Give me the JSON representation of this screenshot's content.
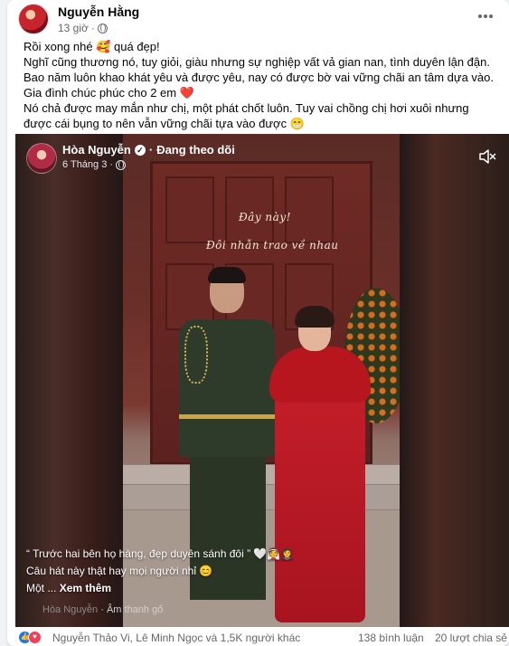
{
  "post": {
    "author": "Nguyễn Hằng",
    "time": "13 giờ",
    "visibility_icon": "globe-icon",
    "caption_lines": [
      "Rồi xong nhé 🥰 quá đẹp!",
      "Nghĩ cũng thương nó, tuy giỏi, giàu nhưng sự nghiệp vất vả gian nan, tình duyên lận đận. Bao năm luôn khao khát yêu và được yêu, nay có được bờ vai vững chãi an tâm dựa vào. Gia đình chúc phúc cho 2 em ❤️",
      "Nó chả được may mắn như chị, một phát chốt luôn. Tuy vai chồng chị hơi xuôi nhưng được cái bụng to nên vẫn vững chãi tựa vào được 😁"
    ]
  },
  "reel": {
    "author": "Hòa Nguyễn",
    "verified_icon": "verified-badge-icon",
    "separator": "·",
    "follow_label": "Đang theo dõi",
    "date": "6 Tháng 3",
    "overlay_text_1": "Đây này!",
    "overlay_text_2": "Đôi nhẫn trao về nhau",
    "caption_line_1": "“ Trước hai bên họ hàng, đẹp duyên sánh đôi ” 🤍👰🤵",
    "caption_line_2": "Câu hát này thật hay mọi người nhỉ 😊",
    "caption_line_3_prefix": "Một ...",
    "see_more": "Xem thêm",
    "audio_author": "Hòa Nguyễn",
    "audio_label": "Âm thanh gố"
  },
  "footer": {
    "reactions_icons": [
      "like-icon",
      "love-icon"
    ],
    "reaction_names": "Nguyễn Thảo Vi, Lê Minh Ngọc và 1,5K người khác",
    "comments": "138 bình luận",
    "shares": "20 lượt chia sẻ"
  }
}
